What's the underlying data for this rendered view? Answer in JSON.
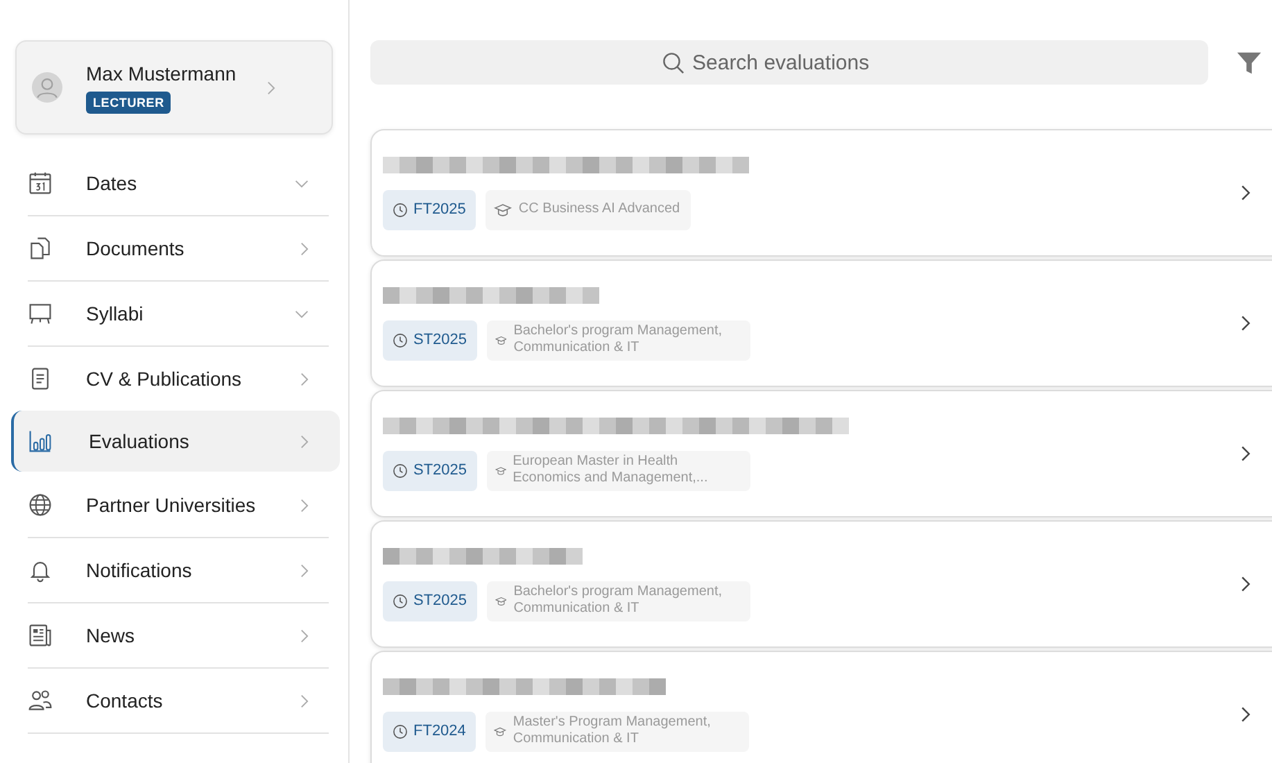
{
  "profile": {
    "name": "Max Mustermann",
    "role": "LECTURER"
  },
  "sidebar": {
    "items": [
      {
        "label": "Dates",
        "kind": "group",
        "selected": false
      },
      {
        "label": "Documents",
        "kind": "link",
        "selected": false
      },
      {
        "label": "Syllabi",
        "kind": "group",
        "selected": false
      },
      {
        "label": "CV & Publications",
        "kind": "link",
        "selected": false
      },
      {
        "label": "Evaluations",
        "kind": "link",
        "selected": true
      },
      {
        "label": "Partner Universities",
        "kind": "link",
        "selected": false
      },
      {
        "label": "Notifications",
        "kind": "link",
        "selected": false
      },
      {
        "label": "News",
        "kind": "link",
        "selected": false
      },
      {
        "label": "Contacts",
        "kind": "link",
        "selected": false
      }
    ]
  },
  "search": {
    "placeholder": "Search evaluations"
  },
  "evaluations": [
    {
      "term": "FT2025",
      "program": "CC Business AI Advanced"
    },
    {
      "term": "ST2025",
      "program": "Bachelor's program Management, Communication & IT"
    },
    {
      "term": "ST2025",
      "program": "European Master in Health Economics and Management,..."
    },
    {
      "term": "ST2025",
      "program": "Bachelor's program Management, Communication & IT"
    },
    {
      "term": "FT2024",
      "program": "Master's Program Management, Communication & IT"
    }
  ]
}
